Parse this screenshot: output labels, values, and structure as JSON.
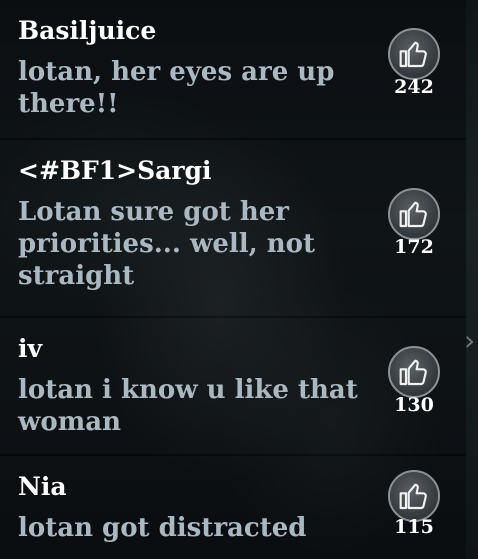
{
  "comments": [
    {
      "username": "Basiljuice",
      "message": "lotan, her eyes are up there!!",
      "likes": "242"
    },
    {
      "username": "<#BF1>Sargi",
      "message": "Lotan sure got her priorities... well, not straight",
      "likes": "172"
    },
    {
      "username": "iv",
      "message": "lotan i know u like that woman",
      "likes": "130"
    },
    {
      "username": "Nia",
      "message": "lotan got distracted",
      "likes": "115"
    }
  ],
  "icons": {
    "like": "thumbs-up-icon",
    "scroll": "chevron-right-icon"
  },
  "colors": {
    "username": "#ffffff",
    "message": "#a9b8c1",
    "like_count": "#ffffff"
  }
}
